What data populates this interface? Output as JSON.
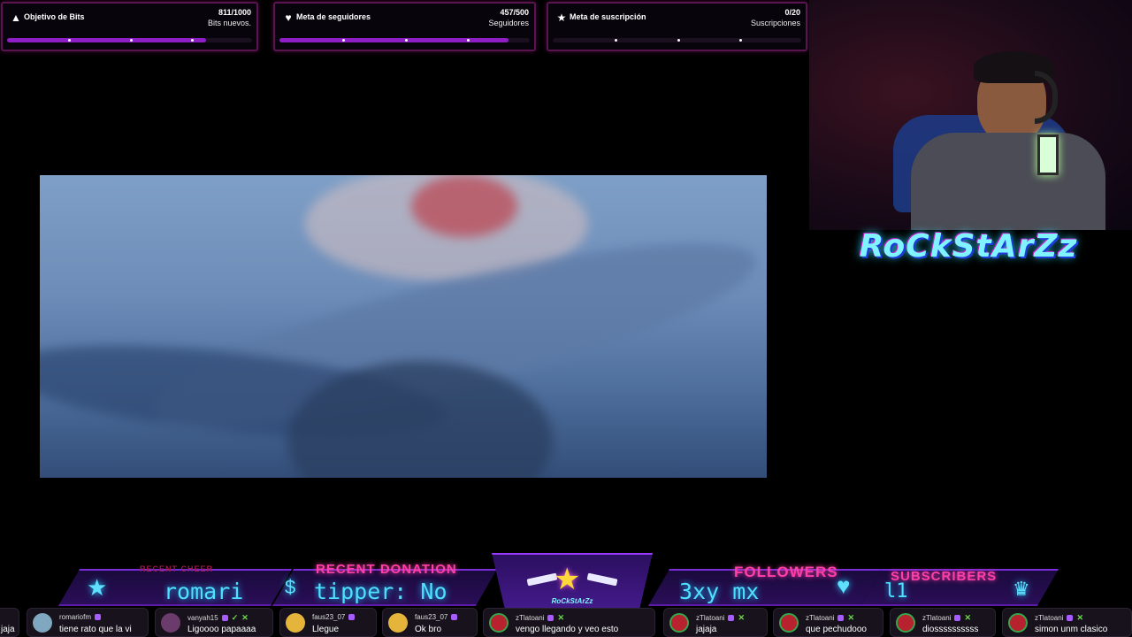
{
  "goals": [
    {
      "title": "Objetivo de Bits",
      "count": "811/1000",
      "sub": "Bits nuevos.",
      "icon": "bits-icon",
      "progress": 0.811
    },
    {
      "title": "Meta de seguidores",
      "count": "457/500",
      "sub": "Seguidores",
      "icon": "heart-icon",
      "progress": 0.914
    },
    {
      "title": "Meta de suscripción",
      "count": "0/20",
      "sub": "Suscripciones",
      "icon": "star-icon",
      "progress": 0.0
    }
  ],
  "brand": {
    "name": "RoCkStArZz",
    "mini": "RoCkStArZz"
  },
  "ribbon": {
    "cheer_title": "RECENT CHEER",
    "cheer_text": "romari",
    "donation_title": "RECENT DONATION",
    "donation_text": "tipper: No",
    "followers_title": "FOLLOWERS",
    "followers_text": "3xy mx",
    "subscribers_title": "SUBSCRIBERS",
    "subscribers_text": "l1"
  },
  "chat": [
    {
      "user": "",
      "text": "jaja"
    },
    {
      "user": "romariofm",
      "text": "tiene rato que la vi"
    },
    {
      "user": "vanyah15",
      "text": "Ligoooo papaaaa"
    },
    {
      "user": "faus23_07",
      "text": "Llegue"
    },
    {
      "user": "faus23_07",
      "text": "Ok bro"
    },
    {
      "user": "zTlatoani",
      "text": "vengo llegando y veo esto"
    },
    {
      "user": "zTlatoani",
      "text": "jajaja"
    },
    {
      "user": "zTlatoani",
      "text": "que pechudooo"
    },
    {
      "user": "zTlatoani",
      "text": "diossssssssss"
    },
    {
      "user": "zTlatoani",
      "text": "simon unm clasico"
    }
  ]
}
